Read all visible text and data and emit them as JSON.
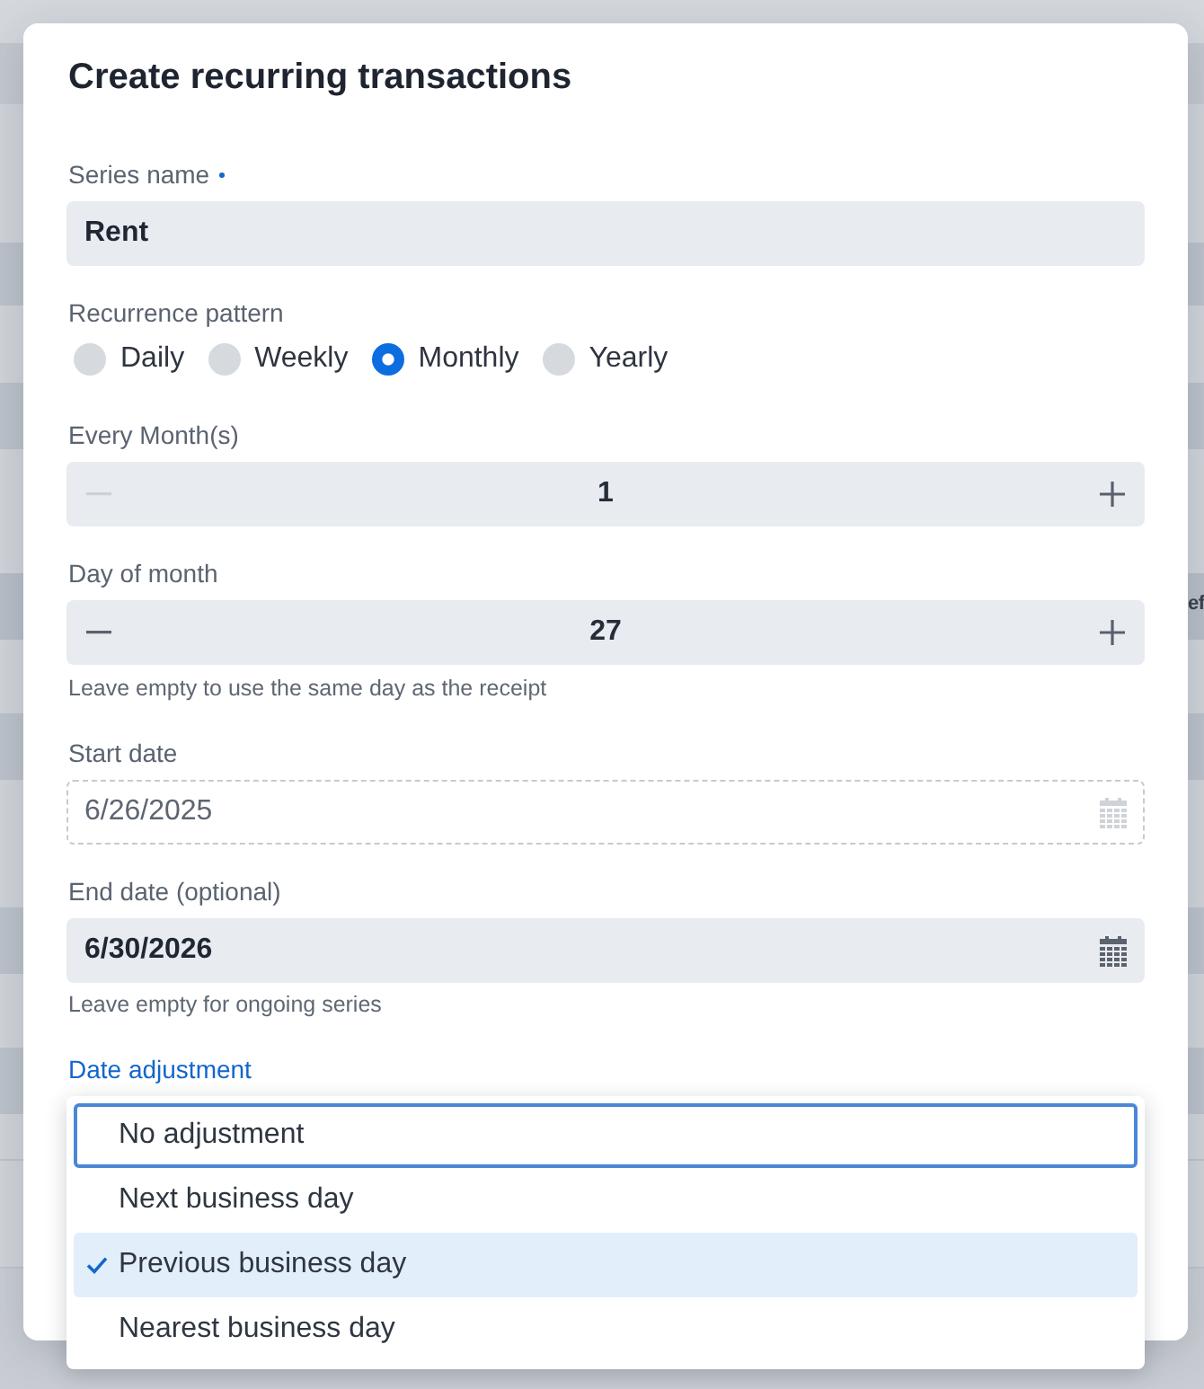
{
  "dialog": {
    "title": "Create recurring transactions"
  },
  "fields": [
    {
      "kind": "text",
      "label": "Series name",
      "required": true,
      "value": "Rent"
    },
    {
      "kind": "radio",
      "label": "Recurrence pattern",
      "required": false,
      "options": [
        {
          "label": "Daily",
          "selected": false
        },
        {
          "label": "Weekly",
          "selected": false
        },
        {
          "label": "Monthly",
          "selected": true
        },
        {
          "label": "Yearly",
          "selected": false
        }
      ]
    },
    {
      "kind": "stepper",
      "label": "Every Month(s)",
      "required": false,
      "value": "1",
      "decrement_disabled": true
    },
    {
      "kind": "stepper",
      "label": "Day of month",
      "required": false,
      "value": "27",
      "decrement_disabled": false,
      "hint": "Leave empty to use the same day as the receipt"
    },
    {
      "kind": "date",
      "label": "Start date",
      "required": false,
      "value": "6/26/2025",
      "disabled": true
    },
    {
      "kind": "date",
      "label": "End date (optional)",
      "required": false,
      "value": "6/30/2026",
      "disabled": false,
      "hint": "Leave empty for ongoing series"
    },
    {
      "kind": "select",
      "label": "Date adjustment",
      "required": false,
      "open": true,
      "options": [
        {
          "label": "No adjustment",
          "focused": true,
          "selected": false
        },
        {
          "label": "Next business day",
          "focused": false,
          "selected": false
        },
        {
          "label": "Previous business day",
          "focused": false,
          "selected": true
        },
        {
          "label": "Nearest business day",
          "focused": false,
          "selected": false
        }
      ]
    }
  ],
  "background": {
    "partial_text": "ef"
  }
}
